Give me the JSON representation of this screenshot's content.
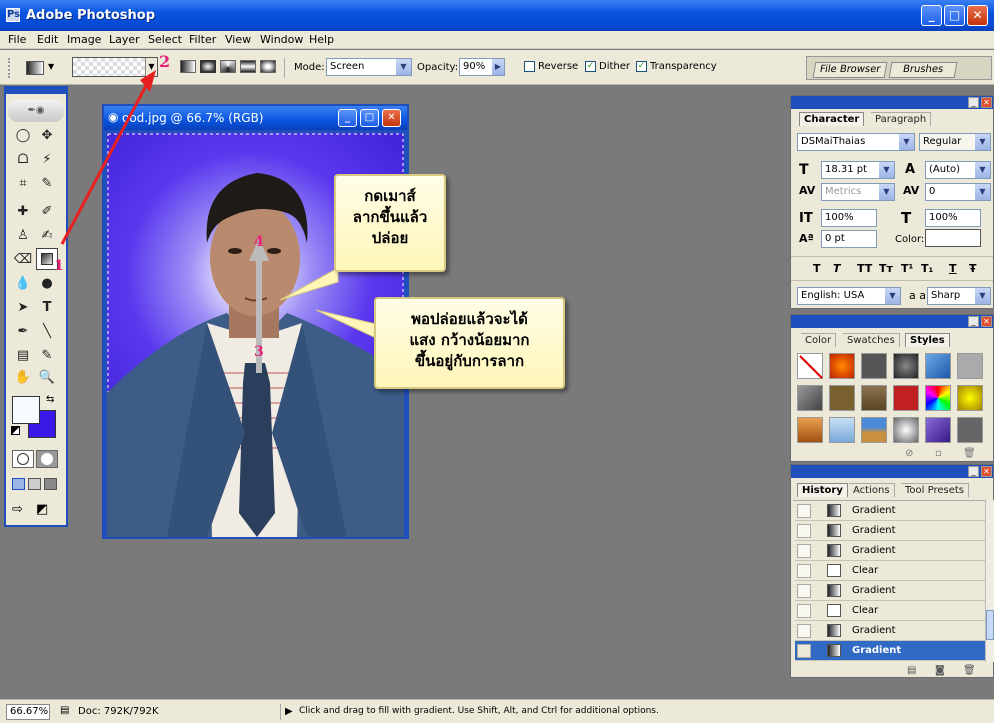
{
  "app": {
    "title": "Adobe Photoshop"
  },
  "menu": [
    "File",
    "Edit",
    "Image",
    "Layer",
    "Select",
    "Filter",
    "View",
    "Window",
    "Help"
  ],
  "options": {
    "mode_label": "Mode:",
    "mode_value": "Screen",
    "opacity_label": "Opacity:",
    "opacity_value": "90%",
    "reverse_label": "Reverse",
    "dither_label": "Dither",
    "transparency_label": "Transparency",
    "reverse_checked": false,
    "dither_checked": true,
    "transparency_checked": true,
    "file_browser": "File Browser",
    "brushes": "Brushes",
    "marker_2": "2"
  },
  "document": {
    "title": "ood.jpg @ 66.7% (RGB)",
    "marker_1": "1",
    "marker_3": "3",
    "marker_4": "4"
  },
  "callouts": {
    "top": "กดเมาส์\nลากขึ้นแล้ว\nปล่อย",
    "bottom": "พอปล่อยแล้วจะได้\nแสง กว้างน้อยมาก\nขึ้นอยู่กับการลาก"
  },
  "character": {
    "tab_active": "Character",
    "tab_other": "Paragraph",
    "font": "DSMaiThaias",
    "style": "Regular",
    "size": "18.31 pt",
    "leading": "(Auto)",
    "kerning": "Metrics",
    "tracking": "0",
    "vscale": "100%",
    "hscale": "100%",
    "baseline": "0 pt",
    "color_label": "Color:",
    "language": "English: USA",
    "aa_label": "a a",
    "antialias": "Sharp",
    "style_buttons": [
      "T",
      "T",
      "TT",
      "Tт",
      "T¹",
      "T₁",
      "T",
      "Ŧ"
    ]
  },
  "styles_panel": {
    "tabs": [
      "Color",
      "Swatches",
      "Styles"
    ],
    "active_tab": "Styles"
  },
  "history": {
    "tabs": [
      "History",
      "Actions",
      "Tool Presets"
    ],
    "active_tab": "History",
    "items": [
      {
        "label": "Gradient",
        "type": "gradient"
      },
      {
        "label": "Gradient",
        "type": "gradient"
      },
      {
        "label": "Gradient",
        "type": "gradient"
      },
      {
        "label": "Clear",
        "type": "clear"
      },
      {
        "label": "Gradient",
        "type": "gradient"
      },
      {
        "label": "Clear",
        "type": "clear"
      },
      {
        "label": "Gradient",
        "type": "gradient"
      },
      {
        "label": "Gradient",
        "type": "gradient",
        "selected": true
      }
    ]
  },
  "status": {
    "zoom": "66.67%",
    "doc": "Doc: 792K/792K",
    "hint": "Click and drag to fill with gradient.  Use Shift, Alt, and Ctrl for additional options."
  },
  "colors": {
    "accent": "#1f4fbd",
    "foreground": "#f4faff",
    "background": "#3a18e8",
    "marker": "#e8207a"
  }
}
